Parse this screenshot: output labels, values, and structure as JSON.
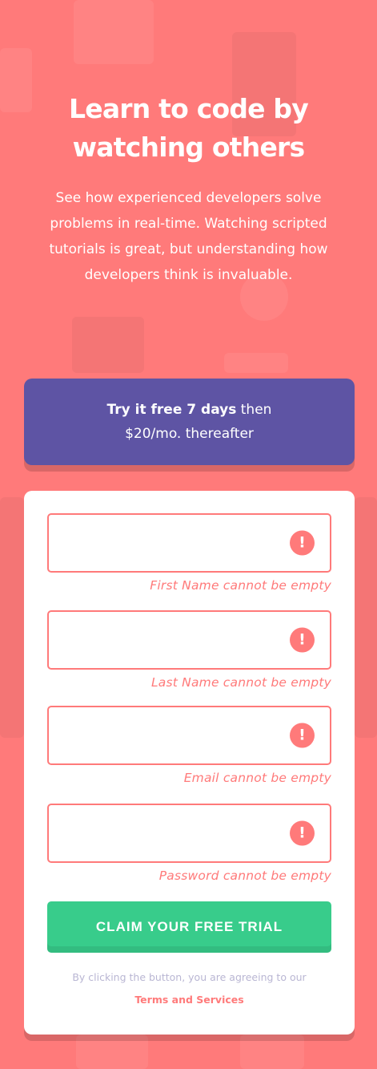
{
  "hero": {
    "title": "Learn to code by watching others",
    "description": "See how experienced developers solve problems in real-time. Watching scripted tutorials is great, but understanding how developers think is invaluable."
  },
  "promo": {
    "bold_text": "Try it free 7 days",
    "rest_text": " then $20/mo. thereafter"
  },
  "form": {
    "fields": [
      {
        "name": "first-name",
        "value": "",
        "error": "First Name cannot be empty"
      },
      {
        "name": "last-name",
        "value": "",
        "error": "Last Name cannot be empty"
      },
      {
        "name": "email",
        "value": "",
        "error": "Email cannot be empty"
      },
      {
        "name": "password",
        "value": "",
        "error": "Password cannot be empty"
      }
    ],
    "error_icon_glyph": "!",
    "submit_label": "CLAIM YOUR FREE TRIAL",
    "terms_prefix": "By clicking the button, you are agreeing to our ",
    "terms_link": "Terms and Services"
  },
  "colors": {
    "background": "#ff7a7a",
    "promo": "#5e54a4",
    "submit": "#38cc8b",
    "error": "#ff7a7a"
  }
}
